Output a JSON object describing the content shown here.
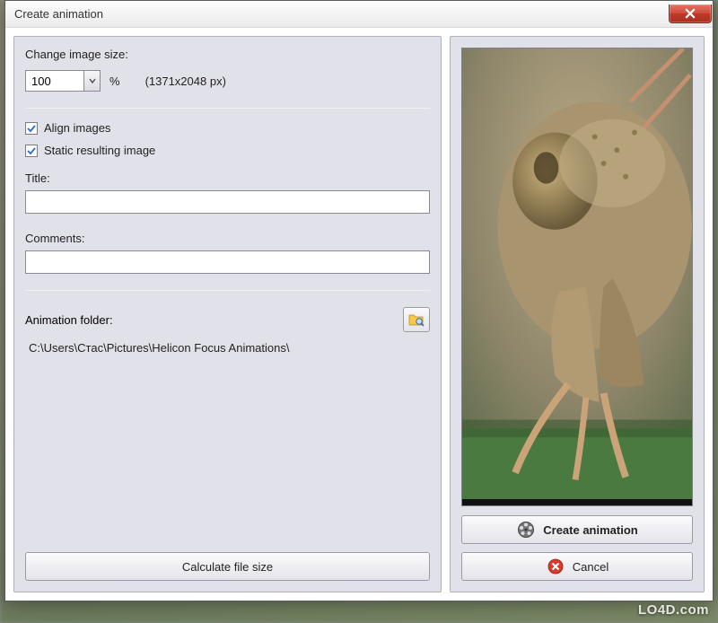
{
  "window": {
    "title": "Create animation"
  },
  "size": {
    "label": "Change image size:",
    "value": "100",
    "unit": "%",
    "dimensions": "(1371x2048 px)"
  },
  "options": {
    "alignLabel": "Align images",
    "alignChecked": true,
    "staticLabel": "Static resulting image",
    "staticChecked": true
  },
  "titleField": {
    "label": "Title:",
    "value": ""
  },
  "commentsField": {
    "label": "Comments:",
    "value": ""
  },
  "folder": {
    "label": "Animation folder:",
    "path": "C:\\Users\\Стас\\Pictures\\Helicon Focus Animations\\"
  },
  "buttons": {
    "calculate": "Calculate file size",
    "create": "Create animation",
    "cancel": "Cancel"
  },
  "watermark": "LO4D.com"
}
